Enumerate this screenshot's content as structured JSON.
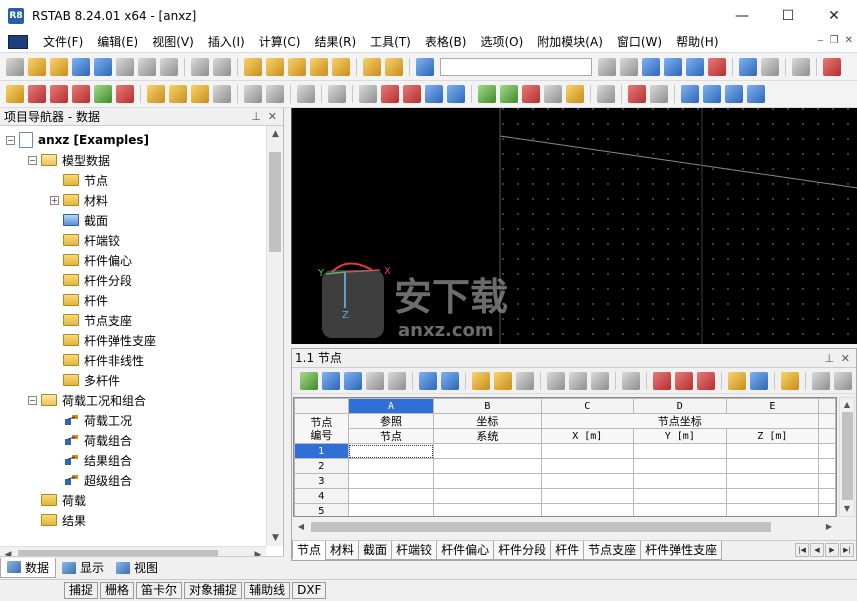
{
  "window": {
    "title": "RSTAB 8.24.01 x64 - [anxz]",
    "app_icon_text": "R8",
    "controls": {
      "minimize": "—",
      "maximize": "☐",
      "close": "✕"
    }
  },
  "menu": {
    "items": [
      "文件(F)",
      "编辑(E)",
      "视图(V)",
      "插入(I)",
      "计算(C)",
      "结果(R)",
      "工具(T)",
      "表格(B)",
      "选项(O)",
      "附加模块(A)",
      "窗口(W)",
      "帮助(H)"
    ],
    "mdi_controls": {
      "minimize": "‒",
      "restore": "❐",
      "close": "✕"
    }
  },
  "toolbar": {
    "combo_value": ""
  },
  "navigator": {
    "title": "项目导航器 - 数据",
    "pin": "⊥",
    "close": "✕",
    "tree": [
      {
        "label": "anxz [Examples]",
        "depth": 0,
        "expander": "−",
        "icon": "doc",
        "bold": true
      },
      {
        "label": "模型数据",
        "depth": 1,
        "expander": "−",
        "icon": "open"
      },
      {
        "label": "节点",
        "depth": 2,
        "expander": "",
        "icon": "folder"
      },
      {
        "label": "材料",
        "depth": 2,
        "expander": "+",
        "icon": "folder"
      },
      {
        "label": "截面",
        "depth": 2,
        "expander": "",
        "icon": "blue"
      },
      {
        "label": "杆端铰",
        "depth": 2,
        "expander": "",
        "icon": "folder"
      },
      {
        "label": "杆件偏心",
        "depth": 2,
        "expander": "",
        "icon": "folder"
      },
      {
        "label": "杆件分段",
        "depth": 2,
        "expander": "",
        "icon": "folder"
      },
      {
        "label": "杆件",
        "depth": 2,
        "expander": "",
        "icon": "folder"
      },
      {
        "label": "节点支座",
        "depth": 2,
        "expander": "",
        "icon": "folder"
      },
      {
        "label": "杆件弹性支座",
        "depth": 2,
        "expander": "",
        "icon": "folder"
      },
      {
        "label": "杆件非线性",
        "depth": 2,
        "expander": "",
        "icon": "folder"
      },
      {
        "label": "多杆件",
        "depth": 2,
        "expander": "",
        "icon": "folder"
      },
      {
        "label": "荷载工况和组合",
        "depth": 1,
        "expander": "−",
        "icon": "open"
      },
      {
        "label": "荷载工况",
        "depth": 2,
        "expander": "",
        "icon": "lc"
      },
      {
        "label": "荷载组合",
        "depth": 2,
        "expander": "",
        "icon": "lc"
      },
      {
        "label": "结果组合",
        "depth": 2,
        "expander": "",
        "icon": "lc"
      },
      {
        "label": "超级组合",
        "depth": 2,
        "expander": "",
        "icon": "lc"
      },
      {
        "label": "荷载",
        "depth": 1,
        "expander": "",
        "icon": "folder"
      },
      {
        "label": "结果",
        "depth": 1,
        "expander": "",
        "icon": "folder"
      }
    ],
    "tabs": [
      {
        "label": "数据",
        "active": true
      },
      {
        "label": "显示",
        "active": false
      },
      {
        "label": "视图",
        "active": false
      }
    ]
  },
  "viewport": {
    "axis_labels": {
      "x": "X",
      "y": "Y",
      "z": "Z"
    },
    "background": "#000000"
  },
  "table_panel": {
    "title": "1.1 节点",
    "pin": "⊥",
    "close": "✕",
    "col_letters": [
      "A",
      "B",
      "C",
      "D",
      "E"
    ],
    "row_header_label_1": "节点",
    "row_header_label_2": "编号",
    "col_a_label_1": "参照",
    "col_a_label_2": "节点",
    "col_b_label_1": "坐标",
    "col_b_label_2": "系统",
    "coord_group_label": "节点坐标",
    "col_c_unit": "X [m]",
    "col_d_unit": "Y [m]",
    "col_e_unit": "Z [m]",
    "rows": [
      "1",
      "2",
      "3",
      "4",
      "5"
    ],
    "sheet_tabs": [
      "节点",
      "材料",
      "截面",
      "杆端铰",
      "杆件偏心",
      "杆件分段",
      "杆件",
      "节点支座",
      "杆件弹性支座"
    ],
    "active_sheet": "节点"
  },
  "statusbar": {
    "buttons": [
      "捕捉",
      "栅格",
      "笛卡尔",
      "对象捕捉",
      "辅助线",
      "DXF"
    ]
  },
  "watermark": {
    "text_main": "安下载",
    "text_sub": "anxz.com"
  },
  "colors": {
    "selection": "#2f6fd6",
    "viewport_bg": "#000000",
    "axis_z": "#4ab3ff",
    "axis_x": "#e23b3b",
    "axis_y": "#3bd14b"
  }
}
